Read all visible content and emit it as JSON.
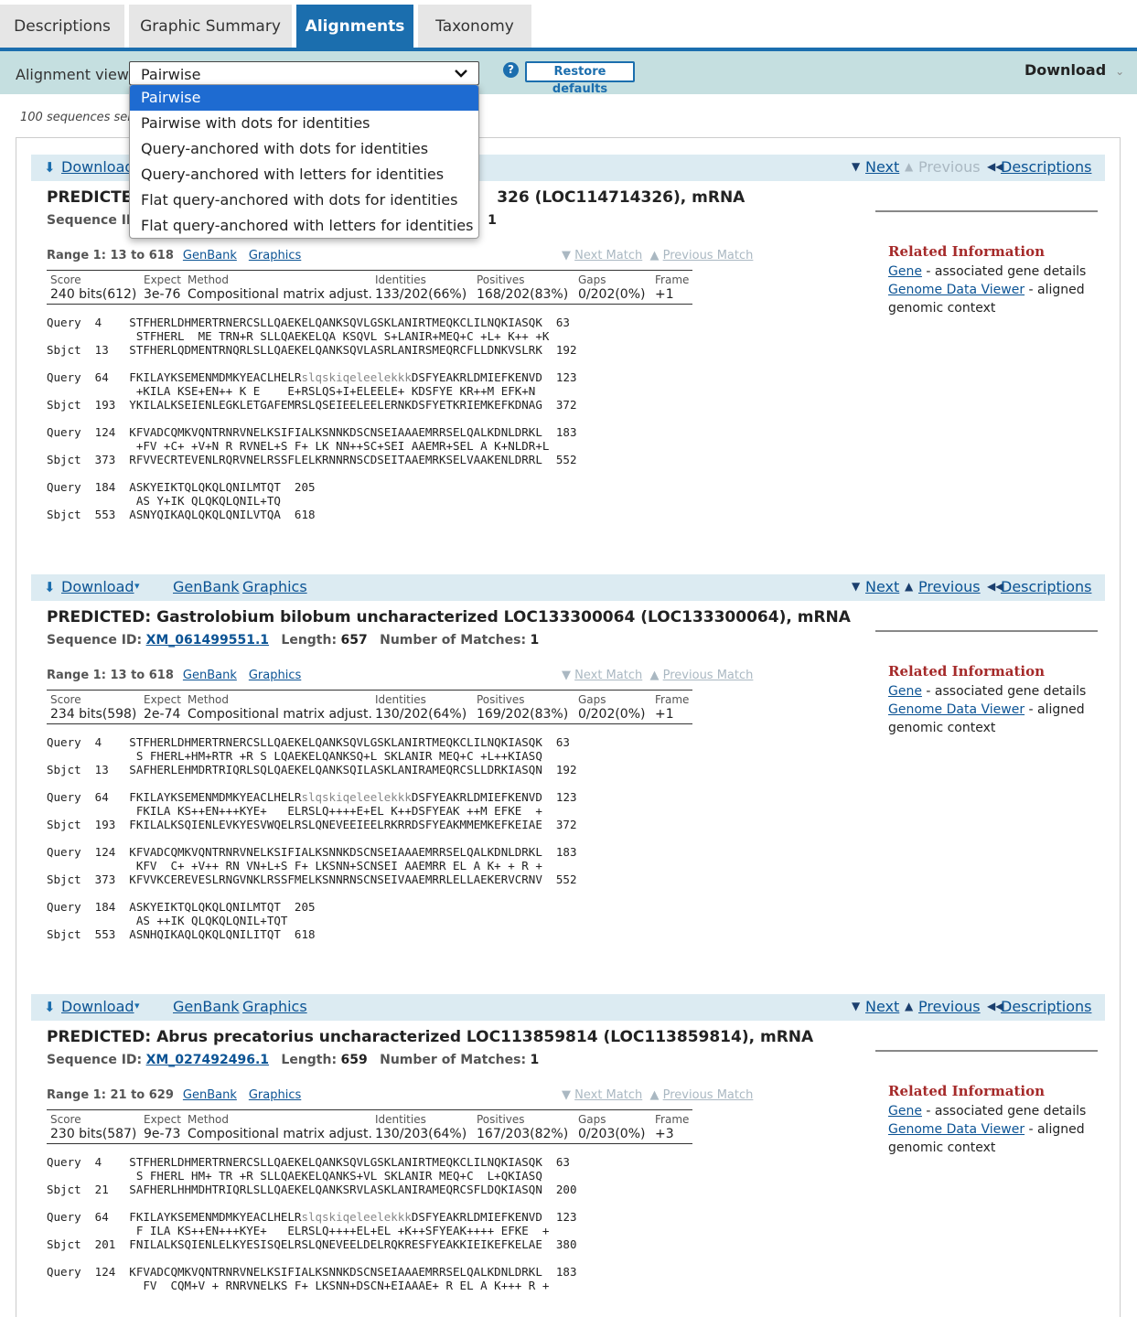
{
  "tabs": [
    "Descriptions",
    "Graphic Summary",
    "Alignments",
    "Taxonomy"
  ],
  "toolbar": {
    "label": "Alignment view",
    "selected": "Pairwise",
    "help": "?",
    "restore": "Restore defaults",
    "download": "Download"
  },
  "selection_info": "100 sequences sele",
  "dropdown": {
    "options": [
      "Pairwise",
      "Pairwise with dots for identities",
      "Query-anchored with dots for identities",
      "Query-anchored with letters for identities",
      "Flat query-anchored with dots for identities",
      "Flat query-anchored with letters for identities"
    ]
  },
  "labels": {
    "download": "Download",
    "genbank": "GenBank",
    "graphics": "Graphics",
    "next": "Next",
    "previous": "Previous",
    "descriptions": "Descriptions",
    "seq_id": "Sequence ID:",
    "length": "Length:",
    "matches": "Number of Matches:",
    "next_match": "Next Match",
    "prev_match": "Previous Match",
    "related_title": "Related Information",
    "gene": "Gene",
    "gene_desc": " - associated gene details",
    "gdv": "Genome Data Viewer",
    "gdv_desc": " - aligned genomic context",
    "col_score": "Score",
    "col_expect": "Expect",
    "col_method": "Method",
    "col_identities": "Identities",
    "col_positives": "Positives",
    "col_gaps": "Gaps",
    "col_frame": "Frame"
  },
  "hits": [
    {
      "title": "PREDICTED:",
      "title_rest": "326 (LOC114714326), mRNA",
      "seq_id": "",
      "length": "",
      "matches": "1",
      "range": "Range 1: 13 to 618",
      "score": "240 bits(612)",
      "expect": "3e-76",
      "method": "Compositional matrix adjust.",
      "identities": "133/202(66%)",
      "positives": "168/202(83%)",
      "gaps": "0/202(0%)",
      "frame": "+1",
      "alignment": [
        [
          "Query  4    STFHERLDHMERTRNERCSLLQAEKELQANKSQVLGSKLANIRTMEQKCLILNQKIASQK  63",
          "",
          ""
        ],
        [
          "             STFHERL  ME TRN+R SLLQAEKELQA KSQVL S+LANIR+MEQ+C +L+ K++ +K",
          "",
          ""
        ],
        [
          "Sbjct  13   STFHERLQDMENTRNQRLSLLQAEKELQANKSQVLASRLANIRSMEQRCFLLDNKVSLRK  192",
          "",
          ""
        ],
        [
          "",
          "",
          ""
        ],
        [
          "Query  64   FKILAYKSEMENMDMKYEACLHELR",
          "slqskiqeleelekkk",
          "DSFYEAKRLDMIEFKENVD  123"
        ],
        [
          "             +KILA KSE+EN++ K E    E+RSLQS+I+ELEELE+ KDSFYE KR++M EFK+N",
          "",
          ""
        ],
        [
          "Sbjct  193  YKILALKSEIENLEGKLETGAFEMRSLQSEIEELEELERNKDSFYETKRIEMKEFKDNAG  372",
          "",
          ""
        ],
        [
          "",
          "",
          ""
        ],
        [
          "Query  124  KFVADCQMKVQNTRNRVNELKSIFIALKSNNKDSCNSEIAAAEMRRSELQALKDNLDRKL  183",
          "",
          ""
        ],
        [
          "             +FV +C+ +V+N R RVNEL+S F+ LK NN++SC+SEI AAEMR+SEL A K+NLDR+L",
          "",
          ""
        ],
        [
          "Sbjct  373  RFVVECRTEVENLRQRVNELRSSFLELKRNNRNSCDSEITAAEMRKSELVAAKENLDRRL  552",
          "",
          ""
        ],
        [
          "",
          "",
          ""
        ],
        [
          "Query  184  ASKYEIKTQLQKQLQNILMTQT  205",
          "",
          ""
        ],
        [
          "             AS Y+IK QLQKQLQNIL+TQ",
          "",
          ""
        ],
        [
          "Sbjct  553  ASNYQIKAQLQKQLQNILVTQA  618",
          "",
          ""
        ]
      ]
    },
    {
      "title": "PREDICTED:",
      "title_rest": " Gastrolobium bilobum uncharacterized LOC133300064 (LOC133300064), mRNA",
      "seq_id": "XM_061499551.1",
      "length": "657",
      "matches": "1",
      "range": "Range 1: 13 to 618",
      "score": "234 bits(598)",
      "expect": "2e-74",
      "method": "Compositional matrix adjust.",
      "identities": "130/202(64%)",
      "positives": "169/202(83%)",
      "gaps": "0/202(0%)",
      "frame": "+1",
      "alignment": [
        [
          "Query  4    STFHERLDHMERTRNERCSLLQAEKELQANKSQVLGSKLANIRTMEQKCLILNQKIASQK  63",
          "",
          ""
        ],
        [
          "             S FHERL+HM+RTR +R S LQAEKELQANKSQ+L SKLANIR MEQ+C +L++KIASQ",
          "",
          ""
        ],
        [
          "Sbjct  13   SAFHERLEHMDRTRIQRLSQLQAEKELQANKSQILASKLANIRAMEQRCSLLDRKIASQN  192",
          "",
          ""
        ],
        [
          "",
          "",
          ""
        ],
        [
          "Query  64   FKILAYKSEMENMDMKYEACLHELR",
          "slqskiqeleelekkk",
          "DSFYEAKRLDMIEFKENVD  123"
        ],
        [
          "             FKILA KS++EN+++KYE+   ELRSLQ++++E+EL K++DSFYEAK ++M EFKE  +",
          "",
          ""
        ],
        [
          "Sbjct  193  FKILALKSQIENLEVKYESVWQELRSLQNEVEEIEELRKRRDSFYEAKMMEMKEFKEIAE  372",
          "",
          ""
        ],
        [
          "",
          "",
          ""
        ],
        [
          "Query  124  KFVADCQMKVQNTRNRVNELKSIFIALKSNNKDSCNSEIAAAEMRRSELQALKDNLDRKL  183",
          "",
          ""
        ],
        [
          "             KFV  C+ +V++ RN VN+L+S F+ LKSNN+SCNSEI AAEMRR EL A K+ + R +",
          "",
          ""
        ],
        [
          "Sbjct  373  KFVVKCEREVESLRNGVNKLRSSFMELKSNNRNSCNSEIVAAEMRRLELLAEKERVCRNV  552",
          "",
          ""
        ],
        [
          "",
          "",
          ""
        ],
        [
          "Query  184  ASKYEIKTQLQKQLQNILMTQT  205",
          "",
          ""
        ],
        [
          "             AS ++IK QLQKQLQNIL+TQT",
          "",
          ""
        ],
        [
          "Sbjct  553  ASNHQIKAQLQKQLQNILITQT  618",
          "",
          ""
        ]
      ]
    },
    {
      "title": "PREDICTED:",
      "title_rest": " Abrus precatorius uncharacterized LOC113859814 (LOC113859814), mRNA",
      "seq_id": "XM_027492496.1",
      "length": "659",
      "matches": "1",
      "range": "Range 1: 21 to 629",
      "score": "230 bits(587)",
      "expect": "9e-73",
      "method": "Compositional matrix adjust.",
      "identities": "130/203(64%)",
      "positives": "167/203(82%)",
      "gaps": "0/203(0%)",
      "frame": "+3",
      "alignment": [
        [
          "Query  4    STFHERLDHMERTRNERCSLLQAEKELQANKSQVLGSKLANIRTMEQKCLILNQKIASQK  63",
          "",
          ""
        ],
        [
          "             S FHERL HM+ TR +R SLLQAEKELQANKS+VL SKLANIR MEQ+C  L+QKIASQ",
          "",
          ""
        ],
        [
          "Sbjct  21   SAFHERLHHMDHTRIQRLSLLQAEKELQANKSRVLASKLANIRAMEQRCSFLDQKIASQN  200",
          "",
          ""
        ],
        [
          "",
          "",
          ""
        ],
        [
          "Query  64   FKILAYKSEMENMDMKYEACLHELR",
          "slqskiqeleelekkk",
          "DSFYEAKRLDMIEFKENVD  123"
        ],
        [
          "             F ILA KS++EN+++KYE+   ELRSLQ++++EL+EL +K++SFYEAK++++ EFKE  +",
          "",
          ""
        ],
        [
          "Sbjct  201  FNILALKSQIENLELKYESISQELRSLQNEVEELDELRQKRESFYEAKKIEIKEFKELAE  380",
          "",
          ""
        ],
        [
          "",
          "",
          ""
        ],
        [
          "Query  124  KFVADCQMKVQNTRNRVNELKSIFIALKSNNKDSCNSEIAAAEMRRSELQALKDNLDRKL  183",
          "",
          ""
        ],
        [
          "              FV  CQM+V + RNRVNELKS F+ LKSNN+DSCN+EIAAAE+ R EL A K+++ R +",
          "",
          ""
        ]
      ]
    }
  ]
}
